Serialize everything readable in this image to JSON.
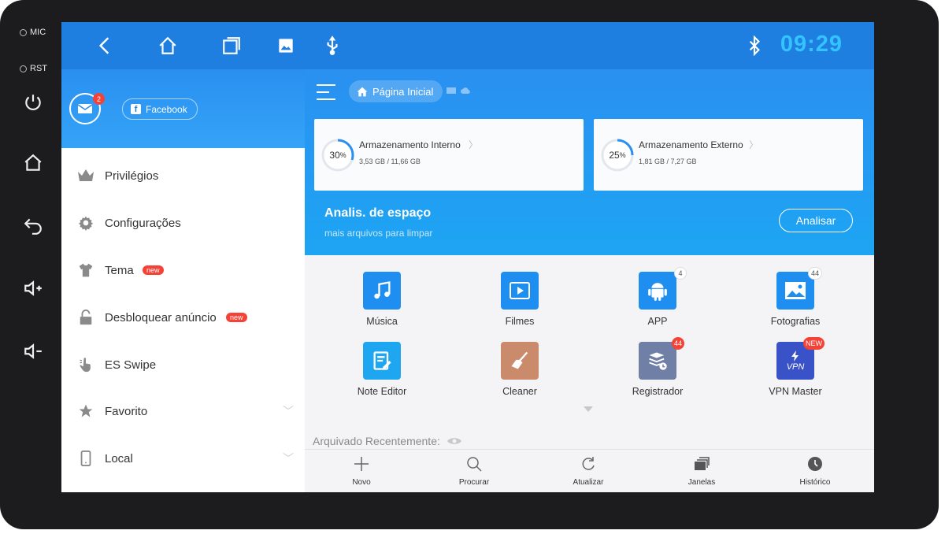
{
  "hardware": {
    "mic_label": "MIC",
    "rst_label": "RST"
  },
  "statusbar": {
    "clock": "09:29",
    "accent_color": "#33c3ff"
  },
  "sidebar": {
    "mail_badge": "2",
    "facebook_label": "Facebook",
    "items": [
      {
        "label": "Privilégios",
        "icon": "crown-icon"
      },
      {
        "label": "Configurações",
        "icon": "gear-icon"
      },
      {
        "label": "Tema",
        "icon": "tshirt-icon",
        "badge": "new"
      },
      {
        "label": "Desbloquear anúncio",
        "icon": "unlock-icon",
        "badge": "new"
      },
      {
        "label": "ES Swipe",
        "icon": "swipe-hand-icon"
      },
      {
        "label": "Favorito",
        "icon": "star-icon"
      },
      {
        "label": "Local",
        "icon": "phone-icon"
      }
    ]
  },
  "main": {
    "breadcrumb": "Página Inicial",
    "storage": [
      {
        "percent": "30",
        "percent_unit": "%",
        "title": "Armazenamento Interno",
        "usage": "3,53 GB / 11,66 GB",
        "fraction": 0.3
      },
      {
        "percent": "25",
        "percent_unit": "%",
        "title": "Armazenamento Externo",
        "usage": "1,81 GB / 7,27 GB",
        "fraction": 0.25
      }
    ],
    "analysis": {
      "title": "Analis. de espaço",
      "subtitle": "mais arquivos para limpar",
      "button": "Analisar"
    },
    "apps": [
      {
        "label": "Música",
        "icon": "music-icon"
      },
      {
        "label": "Filmes",
        "icon": "film-icon"
      },
      {
        "label": "APP",
        "icon": "android-icon",
        "count": "4"
      },
      {
        "label": "Fotografias",
        "icon": "photo-icon",
        "count": "44"
      },
      {
        "label": "Note Editor",
        "icon": "note-icon"
      },
      {
        "label": "Cleaner",
        "icon": "broom-icon"
      },
      {
        "label": "Registrador",
        "icon": "log-icon",
        "count": "44"
      },
      {
        "label": "VPN Master",
        "icon": "vpn-icon",
        "count": "NEW",
        "icon_text": "VPN"
      }
    ],
    "recent_label": "Arquivado Recentemente:",
    "bottom": [
      {
        "label": "Novo",
        "icon": "plus-icon"
      },
      {
        "label": "Procurar",
        "icon": "search-icon"
      },
      {
        "label": "Atualizar",
        "icon": "refresh-icon"
      },
      {
        "label": "Janelas",
        "icon": "windows-icon"
      },
      {
        "label": "Histórico",
        "icon": "clock-icon"
      }
    ]
  }
}
